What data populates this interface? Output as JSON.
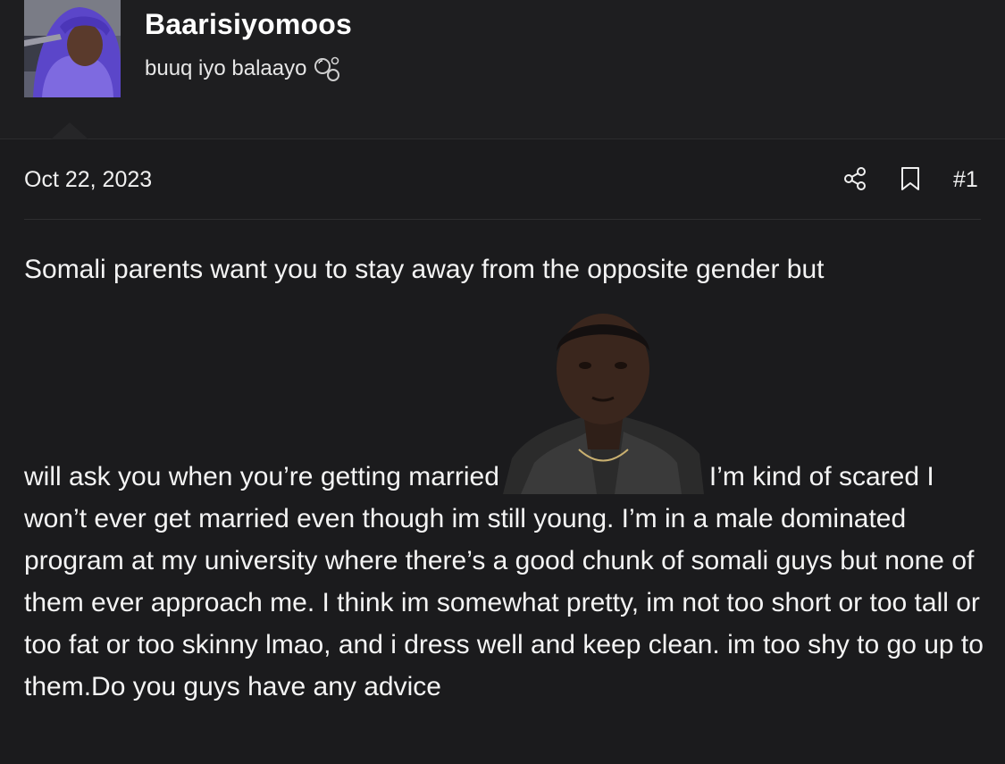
{
  "user": {
    "username": "Baarisiyomoos",
    "title": "buuq iyo balaayo",
    "title_icon": "bubbles-icon"
  },
  "post": {
    "date": "Oct 22, 2023",
    "number": "#1",
    "actions": [
      {
        "name": "share",
        "icon": "share-icon"
      },
      {
        "name": "bookmark",
        "icon": "bookmark-icon"
      }
    ]
  },
  "message": {
    "line1": "Somali parents want you to stay away from the opposite gender but",
    "before_image": "will ask you when you’re getting married",
    "after_image": "I’m kind of scared I won’t ever get married even though im still young. I’m in a male dominated program at my university where there’s a good chunk of somali guys but none of them ever approach me. I think im somewhat pretty, im not too short or too tall or too fat or too skinny lmao, and i dress well and keep clean. im too shy to go up to them.Do you guys have any advice"
  },
  "colors": {
    "background": "#1b1b1d",
    "header_background": "#1e1e20",
    "text": "#f4f4f4",
    "avatar_hijab": "#6a4fd6"
  }
}
